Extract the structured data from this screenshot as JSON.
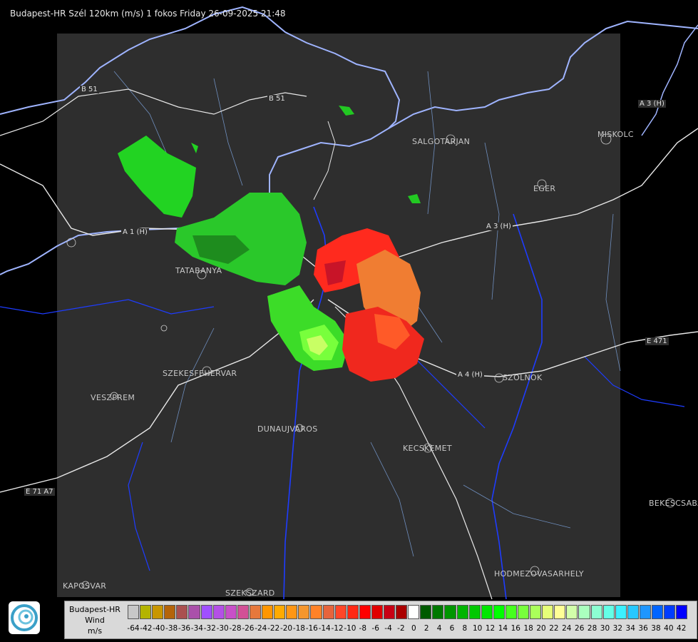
{
  "title": "Budapest-HR Szél 120km (m/s) 1 fokos Friday 26-09-2025 21:48",
  "cities": [
    "SALGOTARJAN",
    "EGER",
    "MISKOLC",
    "TATABANYA",
    "SZEKESFEHERVAR",
    "VESZPREM",
    "DUNAUJVAROS",
    "KECSKEMET",
    "SZOLNOK",
    "BEKESCSABA",
    "HODMEZOVASARHELY",
    "KAPOSVAR",
    "SZEKSZARD"
  ],
  "roads": [
    "B 51",
    "B 51",
    "A 1 (H)",
    "A 3 (H)",
    "A 3 (H)",
    "A 4 (H)",
    "E 471",
    "E 71 A7"
  ],
  "legend": {
    "name": "Budapest-HR",
    "quantity": "Wind",
    "unit": "m/s",
    "colors": [
      "#c8c8c8",
      "#b4b400",
      "#c89600",
      "#b4640a",
      "#aa5050",
      "#aa50aa",
      "#a050ff",
      "#b450e6",
      "#c850c8",
      "#d25096",
      "#e6783c",
      "#ff9600",
      "#ffaa00",
      "#ff9614",
      "#f5962d",
      "#ff8228",
      "#e6643c",
      "#ff4628",
      "#ff2814",
      "#ff0000",
      "#e10000",
      "#c80014",
      "#aa0000",
      "#ffffff",
      "#005a00",
      "#007800",
      "#009600",
      "#00b400",
      "#00c800",
      "#00e600",
      "#00ff00",
      "#46ff1e",
      "#78ff3c",
      "#aaff5a",
      "#e6ff78",
      "#ffff96",
      "#d2ffaa",
      "#aaffbe",
      "#8cffd2",
      "#64ffe6",
      "#3cf0ff",
      "#28c8ff",
      "#1e96ff",
      "#0064ff",
      "#003cff",
      "#0000ff"
    ],
    "ticks": [
      "-64",
      "-42",
      "-40",
      "-38",
      "-36",
      "-34",
      "-32",
      "-30",
      "-28",
      "-26",
      "-24",
      "-22",
      "-20",
      "-18",
      "-16",
      "-14",
      "-12",
      "-10",
      "-8",
      "-6",
      "-4",
      "-2",
      "0",
      "2",
      "4",
      "6",
      "8",
      "10",
      "12",
      "14",
      "16",
      "18",
      "20",
      "22",
      "24",
      "26",
      "28",
      "30",
      "32",
      "34",
      "36",
      "38",
      "40",
      "42"
    ]
  }
}
